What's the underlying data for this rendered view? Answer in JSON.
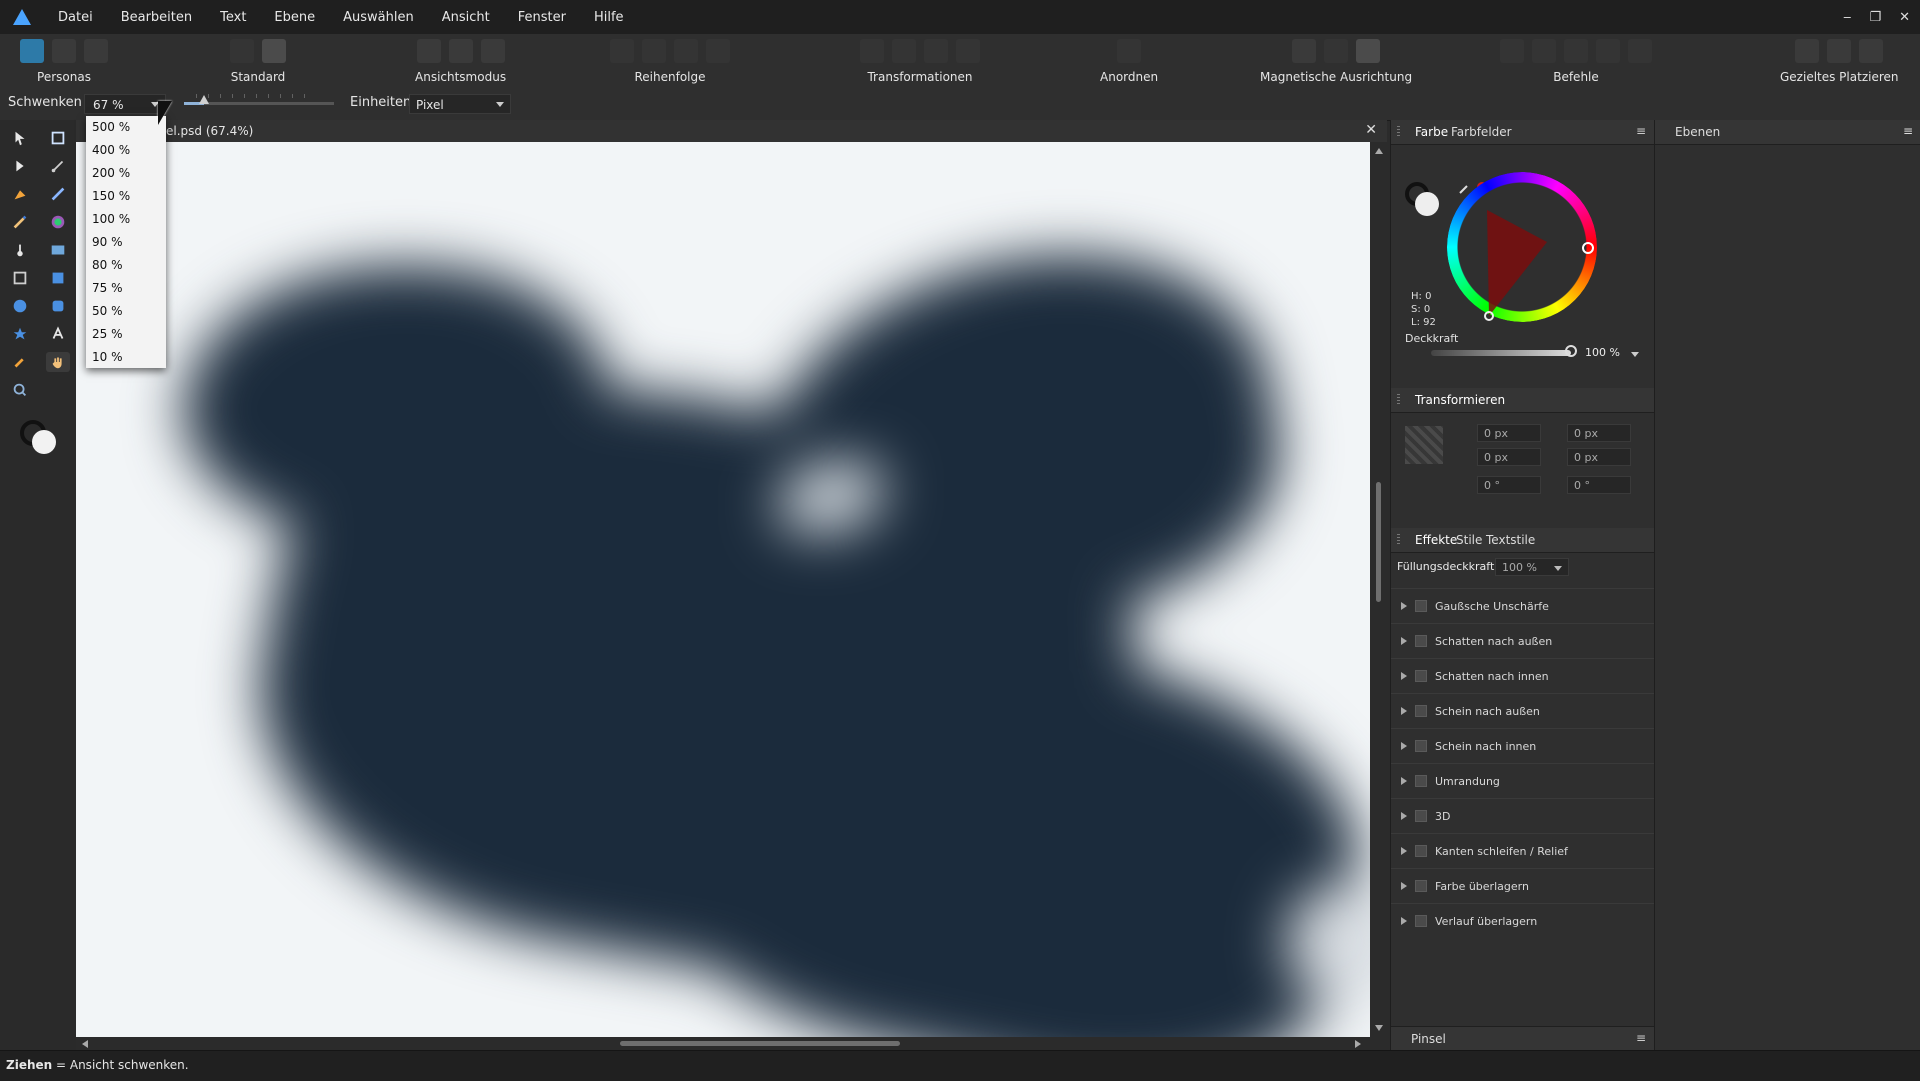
{
  "menubar": {
    "items": [
      "Datei",
      "Bearbeiten",
      "Text",
      "Ebene",
      "Auswählen",
      "Ansicht",
      "Fenster",
      "Hilfe"
    ]
  },
  "toolbar": {
    "groups": {
      "personas": "Personas",
      "standard": "Standard",
      "view_mode": "Ansichtsmodus",
      "order": "Reihenfolge",
      "transformations": "Transformationen",
      "arrange": "Anordnen",
      "snapping": "Magnetische Ausrichtung",
      "commands": "Befehle",
      "placement": "Gezieltes Platzieren"
    }
  },
  "context": {
    "tool_label": "Schwenken",
    "zoom_value": "67 %",
    "units_label": "Einheiten:",
    "units_value": "Pixel",
    "zoom_fraction": 0.67
  },
  "zoom_dropdown": {
    "options": [
      "500 %",
      "400 %",
      "200 %",
      "150 %",
      "100 %",
      "90 %",
      "80 %",
      "75 %",
      "50 %",
      "25 %",
      "10 %"
    ]
  },
  "document": {
    "tab_title": "el.psd (67.4%)",
    "close_glyph": "✕"
  },
  "panels": {
    "color": {
      "tabs": [
        "Farbe",
        "Farbfelder"
      ],
      "h": "H: 0",
      "s": "S: 0",
      "l": "L: 92",
      "opacity_label": "Deckkraft",
      "opacity_value": "100 %",
      "opacity_fraction": 1.0
    },
    "transform": {
      "title": "Transformieren",
      "fields": {
        "x": "0 px",
        "y": "0 px",
        "w": "0 px",
        "h": "0 px",
        "r": "0 °",
        "s": "0 °"
      }
    },
    "effects": {
      "tabs": [
        "Effekte",
        "Stile",
        "Textstile"
      ],
      "fill_opacity_label": "Füllungsdeckkraft:",
      "fill_opacity_value": "100 %",
      "items": [
        "Gaußsche Unschärfe",
        "Schatten nach außen",
        "Schatten nach innen",
        "Schein nach außen",
        "Schein nach innen",
        "Umrandung",
        "3D",
        "Kanten schleifen / Relief",
        "Farbe überlagern",
        "Verlauf überlagern"
      ]
    },
    "brush": {
      "title": "Pinsel"
    },
    "layers": {
      "title": "Ebenen"
    }
  },
  "status": {
    "key": "Ziehen",
    "text": " = Ansicht schwenken."
  },
  "window_controls": {
    "minimize": "‒",
    "maximize": "❐",
    "close": "✕"
  },
  "colors": {
    "accent": "#2d7aa8",
    "canvas_bg": "#f2f5f7",
    "subject": "#1b2b3c"
  },
  "icons": {
    "app": "affinity-photo-logo-icon",
    "cursor": "mouse-pointer-icon"
  }
}
